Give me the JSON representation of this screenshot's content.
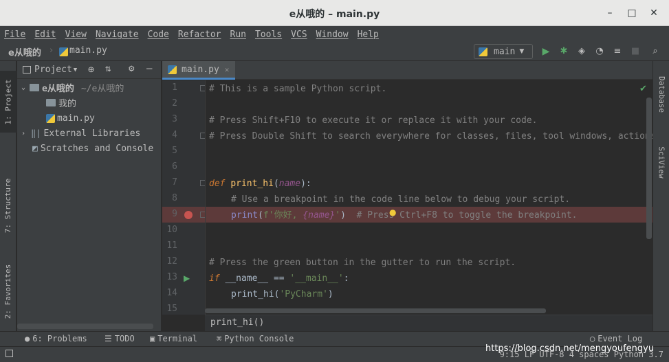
{
  "window": {
    "title": "e从哦的 – main.py"
  },
  "menu": [
    "File",
    "Edit",
    "View",
    "Navigate",
    "Code",
    "Refactor",
    "Run",
    "Tools",
    "VCS",
    "Window",
    "Help"
  ],
  "navbar": {
    "project": "e从哦的",
    "file": "main.py",
    "run_config": "main"
  },
  "left_stripe": {
    "project_tab": "1: Project",
    "structure_tab": "7: Structure",
    "favorites_tab": "2: Favorites"
  },
  "right_stripe": {
    "database_tab": "Database",
    "sciview_tab": "SciView"
  },
  "project_panel": {
    "title": "Project",
    "tree": [
      {
        "label": "e从哦的",
        "extra": "~/e从哦的",
        "level": 0,
        "kind": "folder"
      },
      {
        "label": "我的",
        "level": 1,
        "kind": "folder"
      },
      {
        "label": "main.py",
        "level": 1,
        "kind": "python"
      },
      {
        "label": "External Libraries",
        "level": 0,
        "kind": "library"
      },
      {
        "label": "Scratches and Console",
        "level": 0,
        "kind": "scratch"
      }
    ]
  },
  "editor": {
    "tab": "main.py",
    "line_numbers": [
      "1",
      "2",
      "3",
      "4",
      "5",
      "6",
      "7",
      "8",
      "9",
      "10",
      "11",
      "12",
      "13",
      "14",
      "15"
    ],
    "lines": {
      "l1": "# This is a sample Python script.",
      "l3": "# Press Shift+F10 to execute it or replace it with your code.",
      "l4": "# Press Double Shift to search everywhere for classes, files, tool windows, actions, and settings.",
      "l7_kw": "def",
      "l7_fn": "print_hi",
      "l7_param": "name",
      "l8": "# Use a breakpoint in the code line below to debug your script.",
      "l9_builtin": "print",
      "l9_str1": "f'你好, ",
      "l9_param": "{name}",
      "l9_str2": "'",
      "l9_comment": "# Press Ctrl+F8 to toggle the breakpoint.",
      "l12": "# Press the green button in the gutter to run the script.",
      "l13_kw": "if",
      "l13_name": "__name__",
      "l13_op": "==",
      "l13_str": "'__main__'",
      "l14_fn": "print_hi",
      "l14_str": "'PyCharm'"
    },
    "breadcrumb": "print_hi()"
  },
  "bottom_tools": {
    "problems": "6: Problems",
    "todo": "TODO",
    "terminal": "Terminal",
    "python_console": "Python Console",
    "event_log": "Event Log"
  },
  "status": {
    "text": "9:15  LF  UTF-8  4 spaces  Python 3.7"
  },
  "watermark": "https://blog.csdn.net/mengyoufengyu",
  "colors": {
    "breakpoint_line": "#5d3a3a",
    "run_green": "#59a869",
    "accent": "#4a88c7"
  }
}
